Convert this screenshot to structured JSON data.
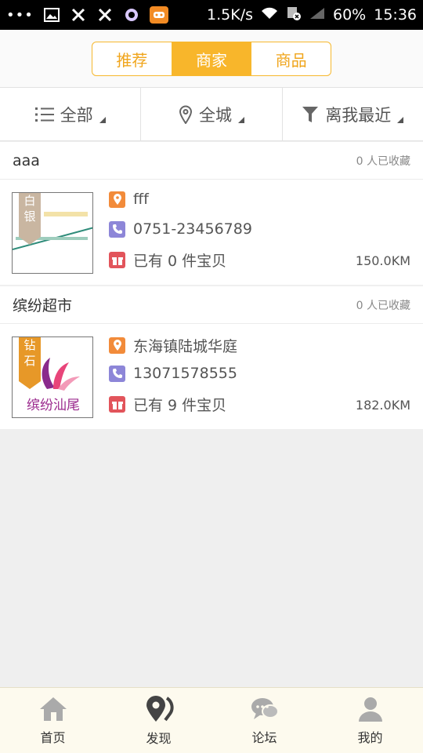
{
  "statusbar": {
    "speed": "1.5K/s",
    "battery": "60%",
    "time": "15:36"
  },
  "segment": {
    "items": [
      {
        "label": "推荐",
        "active": false
      },
      {
        "label": "商家",
        "active": true
      },
      {
        "label": "商品",
        "active": false
      }
    ]
  },
  "filters": {
    "category": "全部",
    "area": "全城",
    "sort": "离我最近"
  },
  "stores": [
    {
      "name": "aaa",
      "favorites": "0 人已收藏",
      "badge": "白银",
      "address": "fff",
      "phone": "0751-23456789",
      "items": "已有 0 件宝贝",
      "distance": "150.0KM"
    },
    {
      "name": "缤纷超市",
      "favorites": "0 人已收藏",
      "badge": "钻石",
      "address": "东海镇陆城华庭",
      "phone": "13071578555",
      "items": "已有 9 件宝贝",
      "distance": "182.0KM",
      "logo_text": "缤纷汕尾"
    }
  ],
  "tabbar": {
    "items": [
      {
        "label": "首页"
      },
      {
        "label": "发现"
      },
      {
        "label": "论坛"
      },
      {
        "label": "我的"
      }
    ]
  },
  "colors": {
    "accent": "#f8b62b",
    "tabbar_bg": "#fdfaee"
  }
}
